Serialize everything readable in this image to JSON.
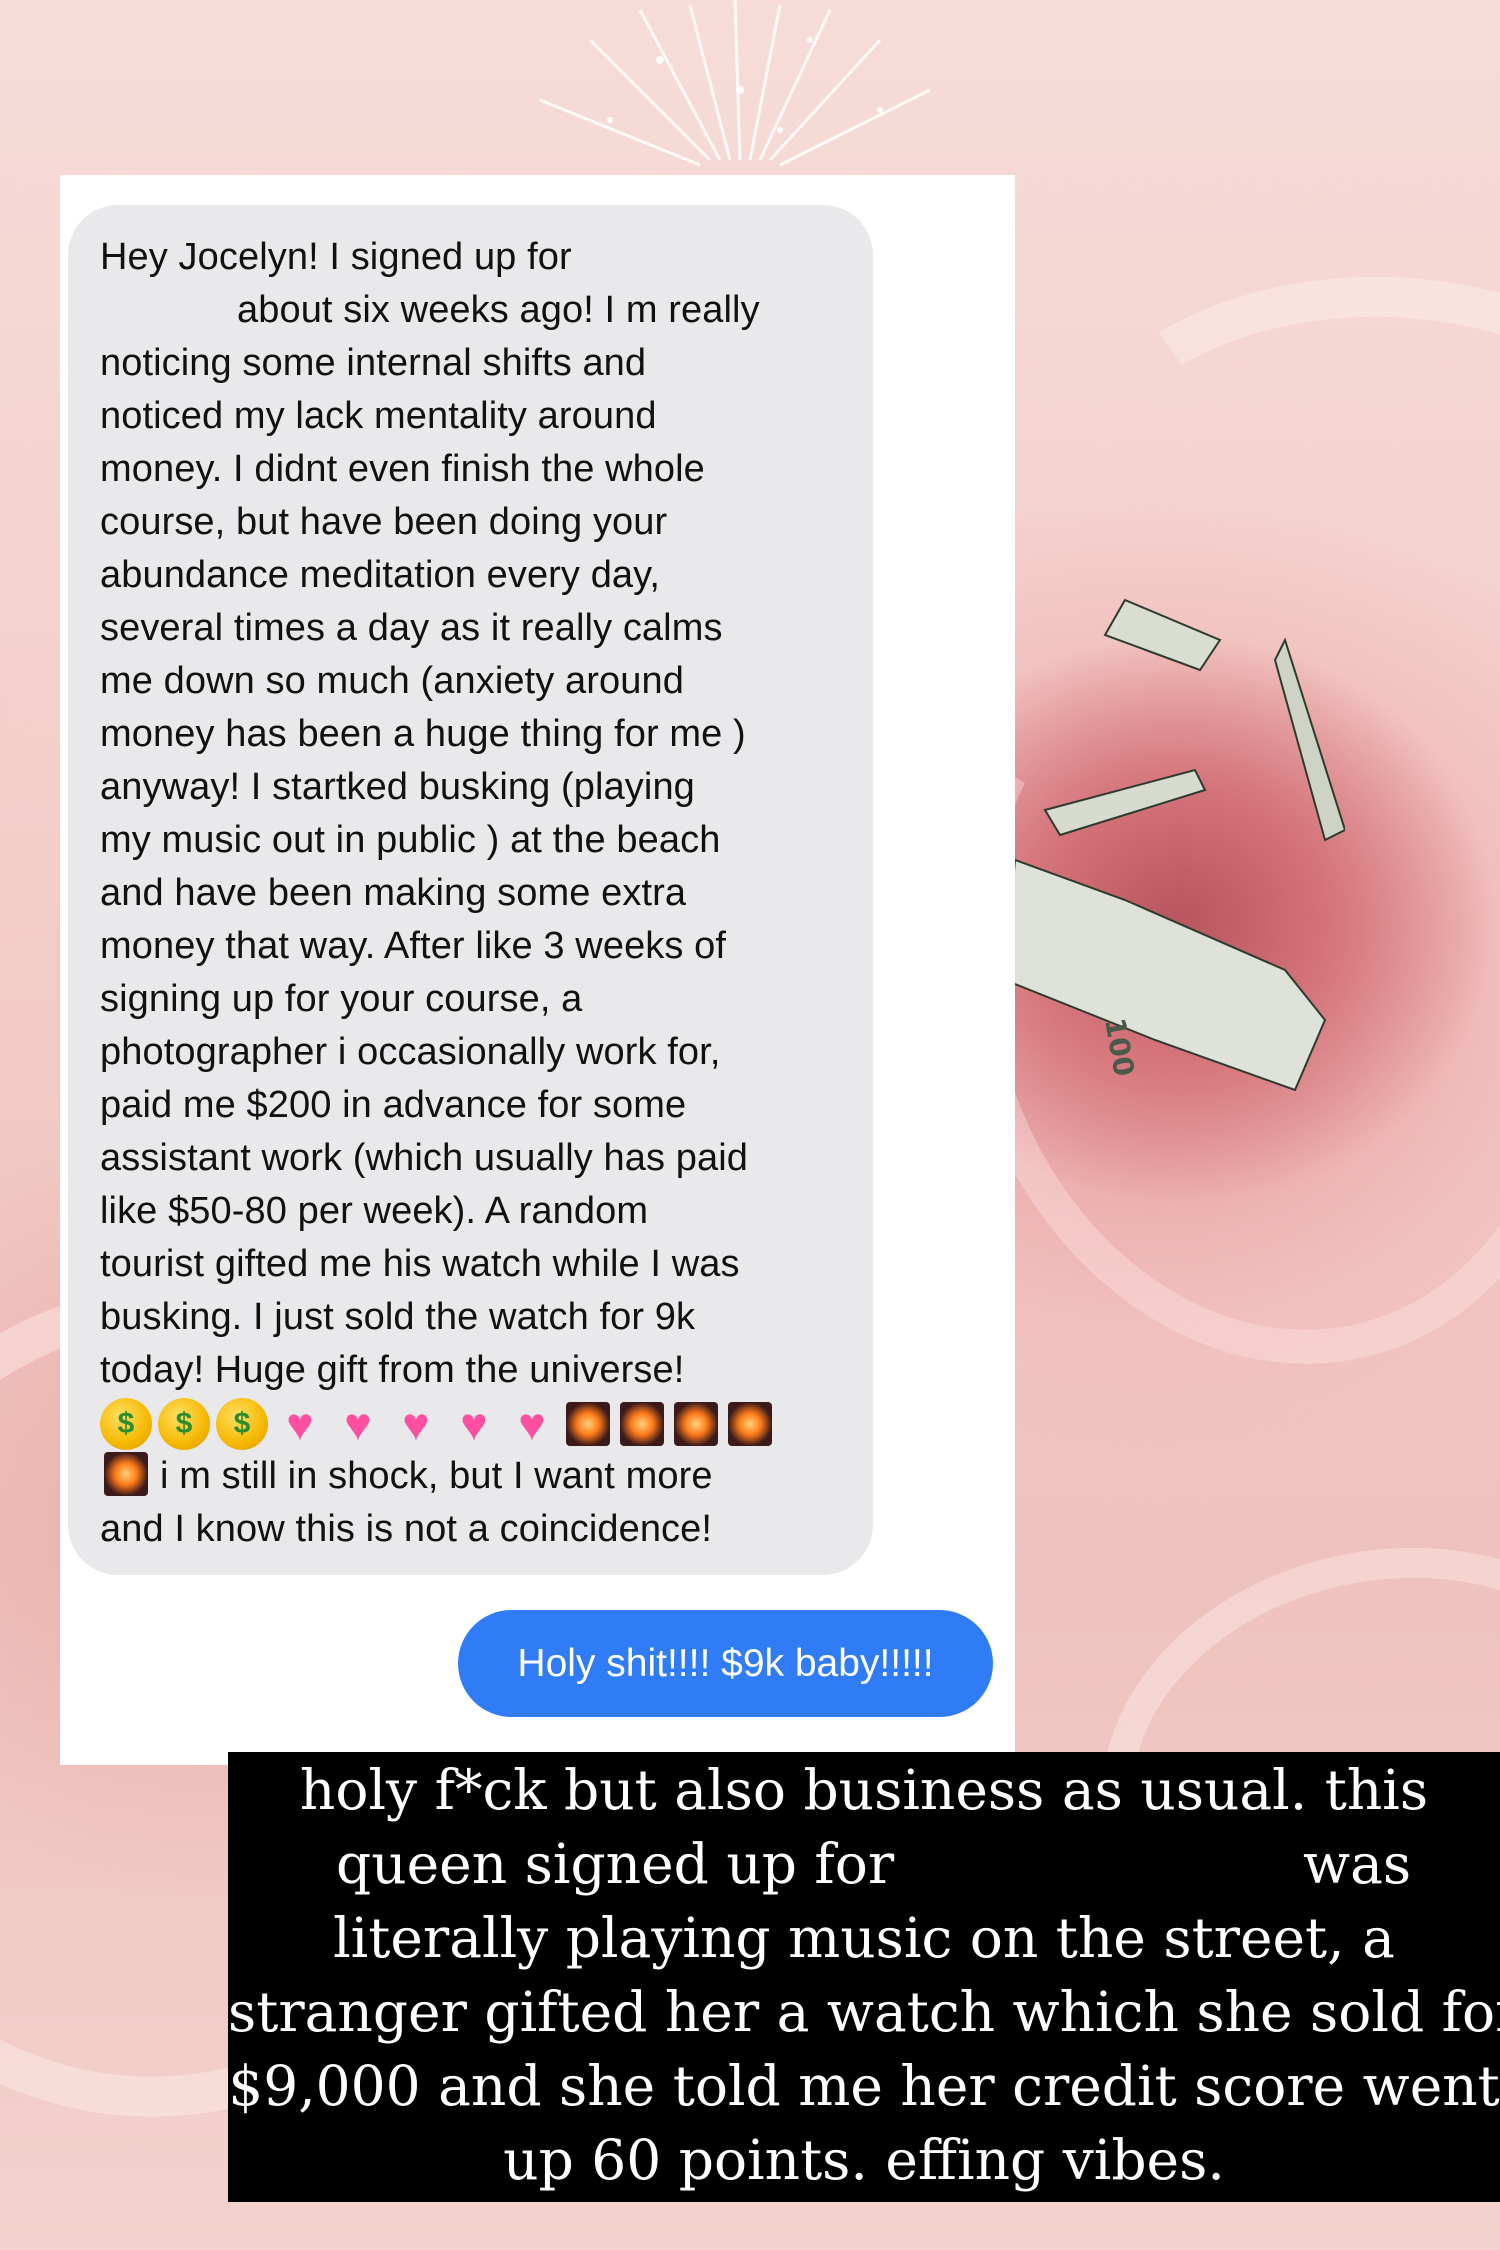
{
  "message": {
    "lines": [
      "Hey Jocelyn! I signed up for",
      "about six weeks ago! I m really",
      "noticing some internal shifts and",
      "noticed my lack mentality around",
      "money. I didnt even finish the whole",
      "course, but have been doing your",
      "abundance meditation every day,",
      "several times a day as it really calms",
      "me down so much (anxiety around",
      "money has been a huge thing for me )",
      "anyway! I startked busking (playing",
      "my music out in public ) at the beach",
      "and have been making some extra",
      "money that way. After like 3 weeks of",
      "signing up for your course, a",
      "photographer i occasionally work for,",
      "paid me $200 in advance for some",
      "assistant work (which usually has paid",
      "like $50-80 per week). A random",
      "tourist gifted me his watch while I was",
      "busking. I just sold the watch for 9k",
      "today! Huge gift from the universe!"
    ],
    "emoji_row": [
      "money-mouth-face",
      "money-mouth-face",
      "money-mouth-face",
      "growing-heart",
      "growing-heart",
      "growing-heart",
      "growing-heart",
      "growing-heart",
      "fireworks",
      "fireworks",
      "fireworks",
      "fireworks"
    ],
    "tail_line_1": "i m still in shock, but I want more",
    "tail_line_2": "and I know this is not a coincidence!"
  },
  "reply": {
    "text": "Holy shit!!!! $9k baby!!!!!"
  },
  "caption": {
    "lines": [
      "holy f*ck but also business as usual. this",
      "queen signed up for",
      "was",
      "literally playing music on the street, a",
      "stranger gifted her a watch which she sold for",
      "$9,000 and she told me her credit score went",
      "up 60 points. effing vibes."
    ]
  },
  "colors": {
    "bubble_gray": "#e9e9eb",
    "reply_blue": "#2f7cf6",
    "caption_bg": "#000000",
    "rose_pink": "#e59a9a"
  }
}
